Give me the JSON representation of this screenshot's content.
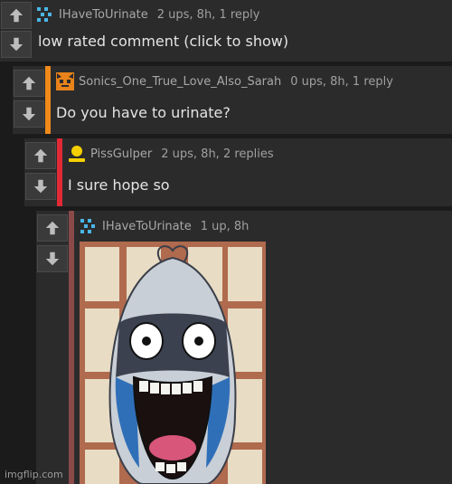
{
  "comments": [
    {
      "username": "IHaveToUrinate",
      "meta": "2 ups, 8h, 1 reply",
      "text": "low rated comment (click to show)",
      "bar_color": "",
      "avatar": "pixel-icon-blue"
    },
    {
      "username": "Sonics_One_True_Love_Also_Sarah",
      "meta": "0 ups, 8h, 1 reply",
      "text": "Do you have to urinate?",
      "bar_color": "#f08a1a",
      "avatar": "cat-face-icon-orange"
    },
    {
      "username": "PissGulper",
      "meta": "2 ups, 8h, 2 replies",
      "text": "I sure hope so",
      "bar_color": "#e02a36",
      "avatar": "person-icon-yellow"
    },
    {
      "username": "IHaveToUrinate",
      "meta": "1 up, 8h",
      "text": "",
      "bar_color": "#8a4a48",
      "avatar": "pixel-icon-blue"
    }
  ],
  "meme_image": {
    "description_icon": "screaming-ghost-cartoon"
  },
  "watermark": "imgflip.com"
}
